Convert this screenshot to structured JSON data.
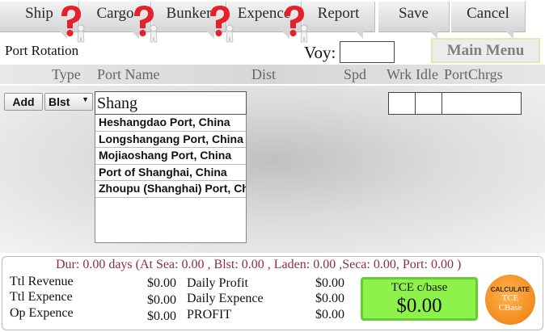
{
  "toolbar": {
    "items": [
      {
        "label": "Ship"
      },
      {
        "label": "Cargo"
      },
      {
        "label": "Bunker"
      },
      {
        "label": "Expence"
      },
      {
        "label": "Report"
      },
      {
        "label": "Save"
      },
      {
        "label": "Cancel"
      }
    ]
  },
  "header": {
    "port_rotation": "Port Rotation",
    "voy_label": "Voy:",
    "voy_value": "",
    "main_menu": "Main Menu"
  },
  "columns": [
    "Type",
    "Port Name",
    "Dist",
    "Spd",
    "Wrk",
    "Idle",
    "PortChrgs"
  ],
  "row": {
    "add_label": "Add",
    "type_value": "Blst",
    "port_input": "Shang"
  },
  "suggestions": [
    "Heshangdao Port, China",
    "Longshangang Port, China",
    "Mojiaoshang Port, China",
    "Port of Shanghai, China",
    "Zhoupu (Shanghai) Port, China"
  ],
  "summary": {
    "duration": "Dur: 0.00 days (At Sea: 0.00 , Blst: 0.00 , Laden: 0.00 ,Seca: 0.00, Port: 0.00 )",
    "ttl_revenue_label": "Ttl Revenue",
    "ttl_revenue_value": "$0.00",
    "ttl_expence_label": "Ttl Expence",
    "ttl_expence_value": "$0.00",
    "op_expence_label": "Op Expence",
    "op_expence_value": "$0.00",
    "daily_profit_label": "Daily Profit",
    "daily_profit_value": "$0.00",
    "daily_expence_label": "Daily Expence",
    "daily_expence_value": "$0.00",
    "profit_label": "PROFIT",
    "profit_value": "$0.00",
    "tce_title": "TCE c/base",
    "tce_value": "$0.00",
    "calc_line1": "CALCULATE",
    "calc_line2": "TCE",
    "calc_line3": "CBase"
  },
  "colors": {
    "tce_green": "#8df24a",
    "calc_orange": "#f28c1e",
    "duration_text": "#8b2c4b"
  },
  "icons": [
    "question-mark-figure-icon"
  ]
}
